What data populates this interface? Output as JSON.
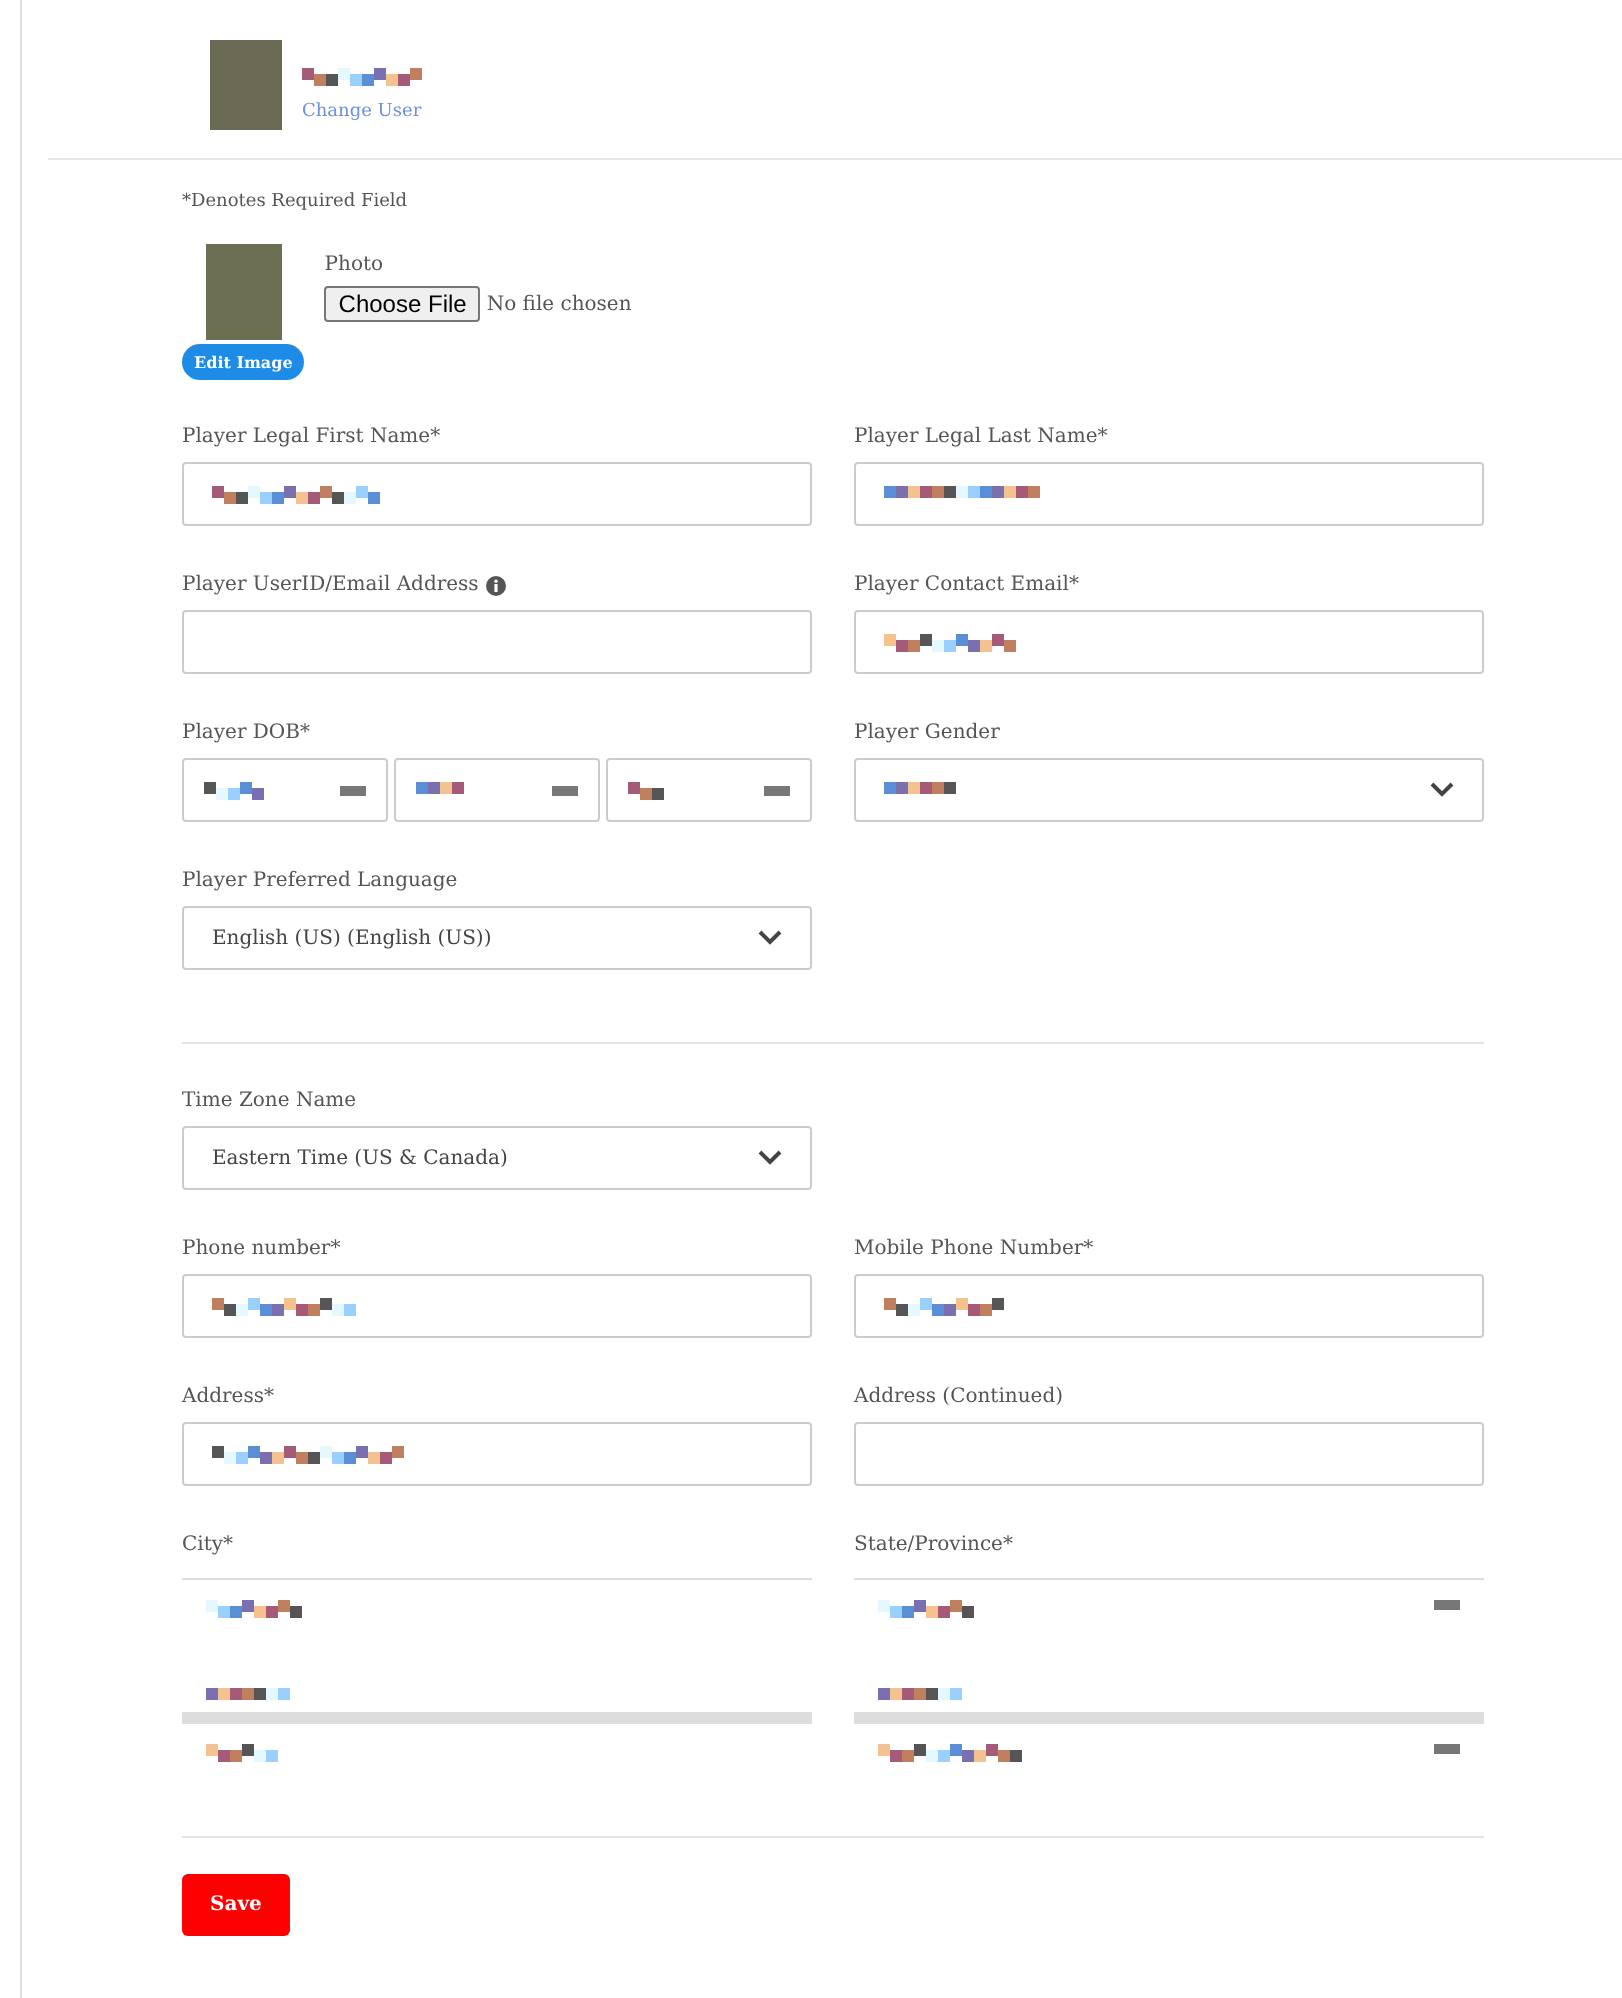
{
  "header": {
    "name_hidden": true,
    "change_user": "Change User"
  },
  "required_note": "*Denotes Required Field",
  "photo": {
    "label": "Photo",
    "button": "Choose File",
    "status": "No file chosen",
    "edit": "Edit Image"
  },
  "sections": [
    [
      {
        "label": "Player Legal First Name*",
        "kind": "text",
        "value_hidden": true
      },
      {
        "label": "Player Legal Last Name*",
        "kind": "text",
        "value_hidden": true
      },
      {
        "label": "Player UserID/Email Address",
        "kind": "text",
        "info": true,
        "value_hidden": false
      },
      {
        "label": "Player Contact Email*",
        "kind": "text",
        "value_hidden": true
      },
      {
        "label": "Player DOB*",
        "kind": "date",
        "value_hidden": true
      },
      {
        "label": "Player Gender",
        "kind": "select",
        "value_hidden": true
      },
      {
        "label": "Player Preferred Language",
        "kind": "select",
        "value": "English (US) (English (US))"
      }
    ],
    [
      {
        "label": "Time Zone Name",
        "kind": "select",
        "value": "Eastern Time (US & Canada)"
      },
      {
        "kind": "spacer"
      },
      {
        "label": "Phone number*",
        "kind": "text",
        "value_hidden": true
      },
      {
        "label": "Mobile Phone Number*",
        "kind": "text",
        "value_hidden": true
      },
      {
        "label": "Address*",
        "kind": "text",
        "value_hidden": true
      },
      {
        "label": "Address (Continued)",
        "kind": "text",
        "value_hidden": false
      },
      {
        "label": "City*",
        "kind": "list",
        "marks": false
      },
      {
        "label": "State/Province*",
        "kind": "list",
        "marks": true
      }
    ]
  ],
  "save": "Save"
}
